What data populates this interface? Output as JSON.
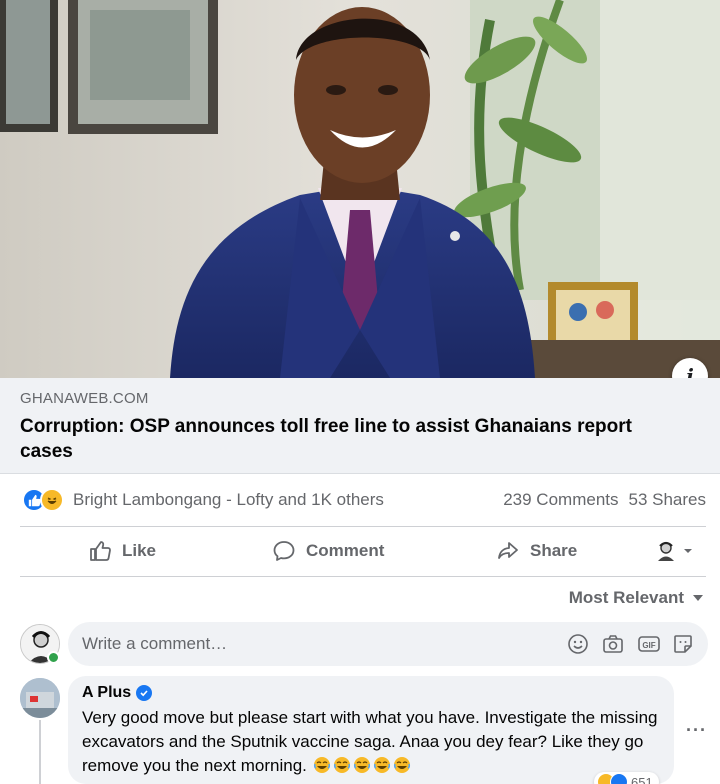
{
  "link_preview": {
    "domain": "GHANAWEB.COM",
    "title": "Corruption: OSP announces toll free line to assist Ghanaians report cases",
    "info_icon": "i"
  },
  "reactions_summary": {
    "icons": [
      "like-icon",
      "haha-icon"
    ],
    "reactors_text": "Bright Lambongang - Lofty and 1K others",
    "comments": "239 Comments",
    "shares": "53 Shares"
  },
  "actions": {
    "like": "Like",
    "comment": "Comment",
    "share": "Share"
  },
  "sort": {
    "label": "Most Relevant"
  },
  "composer": {
    "placeholder": "Write a comment…",
    "icons": [
      "emoji-icon",
      "camera-icon",
      "gif-icon",
      "sticker-icon"
    ]
  },
  "comment": {
    "author": "A Plus",
    "verified": true,
    "text": "Very good move but please start with what you have. Investigate the missing excavators and the Sputnik vaccine saga. Anaa you dey fear? Like they go remove you the next morning.",
    "emoji": "laughing-emoji",
    "emoji_count": 5,
    "reaction_count": "651"
  },
  "colors": {
    "brand_blue": "#1877f2",
    "secondary_text": "#65676b",
    "surface_gray": "#f0f2f5",
    "haha_yellow": "#f7b928"
  }
}
